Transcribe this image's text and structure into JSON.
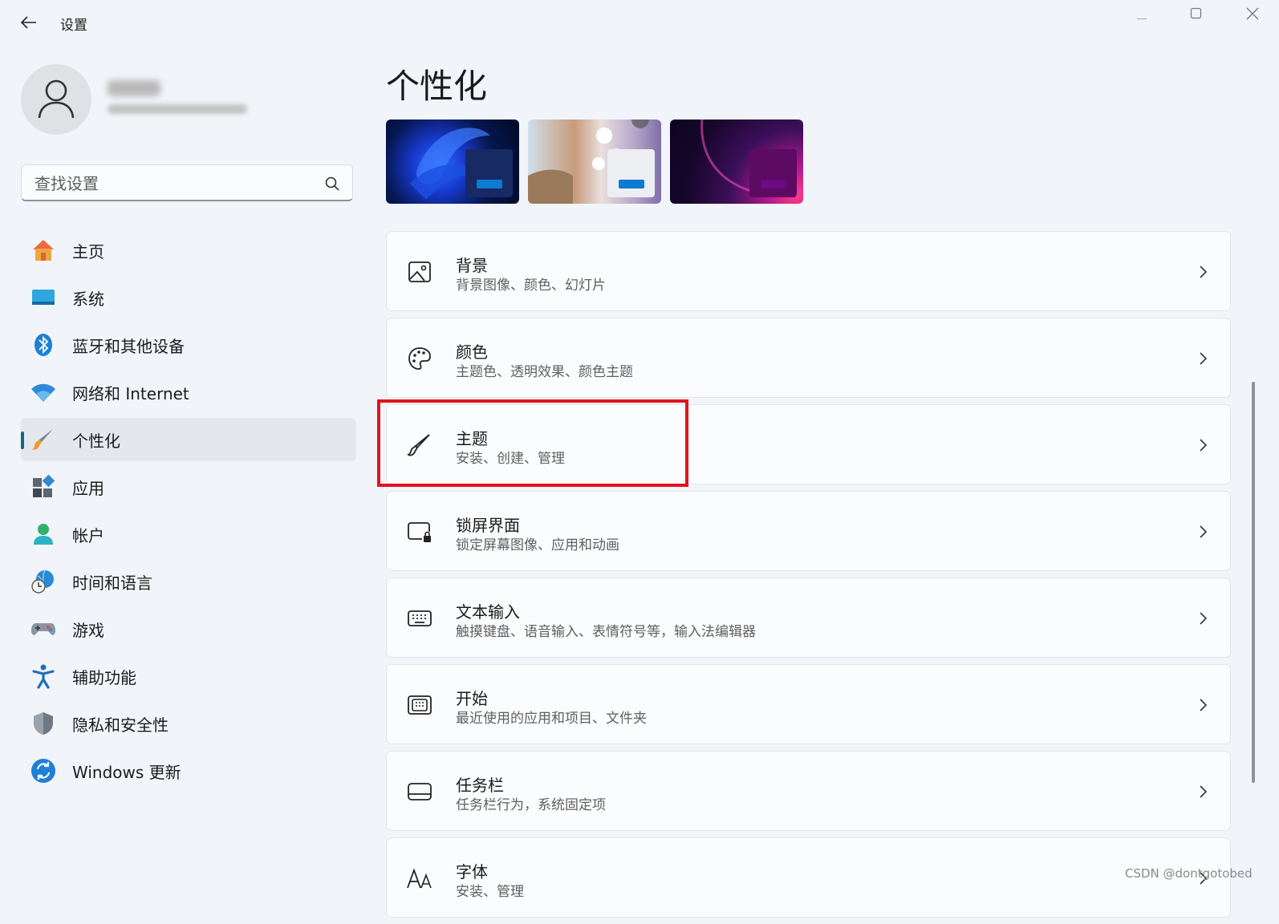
{
  "window": {
    "title": "设置",
    "controls": {
      "minimize": "minimize-icon",
      "maximize": "maximize-icon",
      "close": "close-icon"
    }
  },
  "user": {
    "avatar_icon": "person-icon"
  },
  "search": {
    "placeholder": "查找设置",
    "value": ""
  },
  "nav": {
    "active_index": 4,
    "items": [
      {
        "label": "主页",
        "icon": "home-icon"
      },
      {
        "label": "系统",
        "icon": "system-icon"
      },
      {
        "label": "蓝牙和其他设备",
        "icon": "bluetooth-icon"
      },
      {
        "label": "网络和 Internet",
        "icon": "wifi-icon"
      },
      {
        "label": "个性化",
        "icon": "brush-icon"
      },
      {
        "label": "应用",
        "icon": "apps-icon"
      },
      {
        "label": "帐户",
        "icon": "account-icon"
      },
      {
        "label": "时间和语言",
        "icon": "globe-clock-icon"
      },
      {
        "label": "游戏",
        "icon": "gamepad-icon"
      },
      {
        "label": "辅助功能",
        "icon": "accessibility-icon"
      },
      {
        "label": "隐私和安全性",
        "icon": "shield-icon"
      },
      {
        "label": "Windows 更新",
        "icon": "update-icon"
      }
    ]
  },
  "main": {
    "title": "个性化",
    "themes": [
      {
        "name": "windows-light-bloom",
        "accent": "#0078d4"
      },
      {
        "name": "flowers",
        "accent": "#0078d4"
      },
      {
        "name": "glow",
        "accent": "#6b0a82"
      }
    ],
    "settings": [
      {
        "title": "背景",
        "subtitle": "背景图像、颜色、幻灯片",
        "icon": "image-icon"
      },
      {
        "title": "颜色",
        "subtitle": "主题色、透明效果、颜色主题",
        "icon": "palette-icon"
      },
      {
        "title": "主题",
        "subtitle": "安装、创建、管理",
        "icon": "brush-icon"
      },
      {
        "title": "锁屏界面",
        "subtitle": "锁定屏幕图像、应用和动画",
        "icon": "lock-screen-icon"
      },
      {
        "title": "文本输入",
        "subtitle": "触摸键盘、语音输入、表情符号等，输入法编辑器",
        "icon": "keyboard-icon"
      },
      {
        "title": "开始",
        "subtitle": "最近使用的应用和项目、文件夹",
        "icon": "start-icon"
      },
      {
        "title": "任务栏",
        "subtitle": "任务栏行为，系统固定项",
        "icon": "taskbar-icon"
      },
      {
        "title": "字体",
        "subtitle": "安装、管理",
        "icon": "font-icon"
      }
    ]
  },
  "annotation": {
    "highlighted_item": "主题",
    "color": "#e3121d"
  },
  "watermark": "CSDN @dontgotobed"
}
